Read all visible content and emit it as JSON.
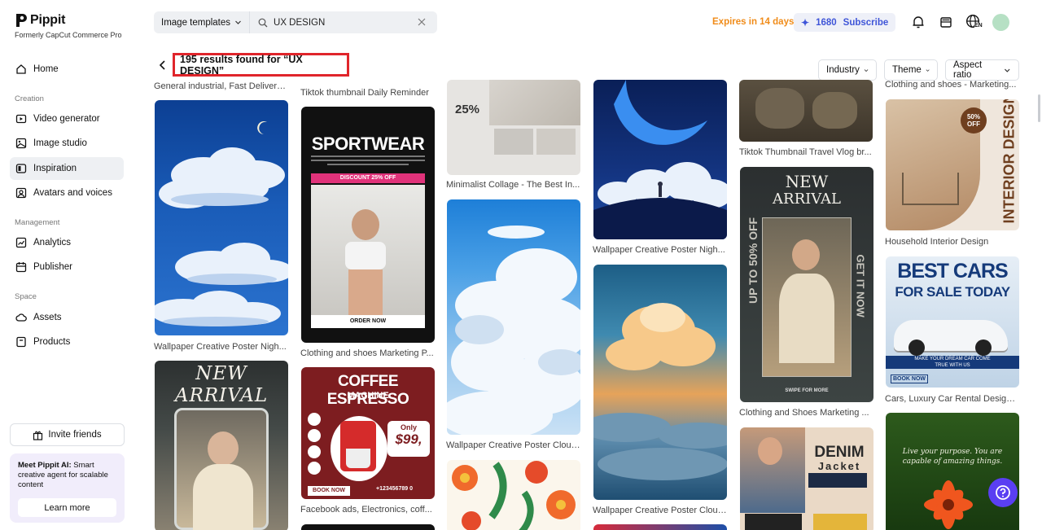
{
  "brand": {
    "name": "Pippit",
    "subtitle": "Formerly CapCut Commerce Pro"
  },
  "sidebar": {
    "home": "Home",
    "sections": {
      "creation": "Creation",
      "management": "Management",
      "space": "Space"
    },
    "items": [
      {
        "label": "Video generator",
        "icon": "video-icon"
      },
      {
        "label": "Image studio",
        "icon": "image-icon"
      },
      {
        "label": "Inspiration",
        "icon": "inspiration-icon",
        "active": true
      },
      {
        "label": "Avatars and voices",
        "icon": "avatar-icon"
      },
      {
        "label": "Analytics",
        "icon": "chart-icon"
      },
      {
        "label": "Publisher",
        "icon": "calendar-icon"
      },
      {
        "label": "Assets",
        "icon": "cloud-icon"
      },
      {
        "label": "Products",
        "icon": "box-icon"
      }
    ],
    "invite": "Invite friends",
    "promo": {
      "title": "Meet Pippit AI:",
      "text": " Smart creative agent for scalable content",
      "button": "Learn more"
    }
  },
  "topbar": {
    "search_type": "Image templates",
    "search_value": "UX DESIGN",
    "expires": "Expires in 14 days",
    "credits": "1680",
    "subscribe": "Subscribe",
    "lang_label": "EN"
  },
  "results": {
    "title": "195 results found for “UX DESIGN”",
    "filters": [
      "Industry",
      "Theme",
      "Aspect ratio"
    ]
  },
  "cards": {
    "col1_top_caption": "General industrial, Fast Delivery,...",
    "c1a": "Wallpaper Creative Poster Nigh...",
    "c1b_title": "NEW ARRIVAL",
    "col2_top_caption": "Tiktok thumbnail Daily Reminder",
    "c2a": "Clothing and shoes Marketing P...",
    "c2a_title": "SPORTWEAR",
    "c2a_discount": "DISCOUNT 25% OFF",
    "c2a_order": "ORDER NOW",
    "c2b": "Facebook ads, Electronics, coff...",
    "c2b_title": "COFFEE ESPRESSO",
    "c2b_sub": "MACHINE",
    "c2b_only": "Only",
    "c2b_price": "$99,",
    "c2b_book": "BOOK NOW",
    "c2b_phone": "+123456789 0",
    "c3a": "Minimalist Collage - The Best In...",
    "c3a_pct": "25%",
    "c3b": "Wallpaper Creative Poster Clouds",
    "c4a": "Wallpaper Creative Poster Nigh...",
    "c4b": "Wallpaper Creative Poster Clouds",
    "c5_top_caption": "Tiktok Thumbnail Travel Vlog br...",
    "c5a": "Clothing and Shoes Marketing ...",
    "c5a_title1": "NEW",
    "c5a_title2": "ARRIVAL",
    "c5a_side": "UP TO 50% OFF",
    "c5a_side2": "GET IT NOW",
    "c5a_swipe": "SWIPE FOR MORE",
    "c5b_title": "DENIM",
    "c5b_sub": "Jacket",
    "c6_top_caption": "Clothing and shoes - Marketing...",
    "c6a": "Household Interior Design",
    "c6a_badge": "50% OFF",
    "c6a_title": "INTERIOR DESIGN",
    "c6b": "Cars, Luxury Car Rental Design,...",
    "c6b_title1": "BEST CARS",
    "c6b_title2": "FOR SALE TODAY",
    "c6b_line": "MAKE YOUR DREAM CAR COME TRUE WITH US",
    "c6b_book": "BOOK NOW",
    "c6b_quote": "Live your purpose. You are capable of amazing things."
  }
}
